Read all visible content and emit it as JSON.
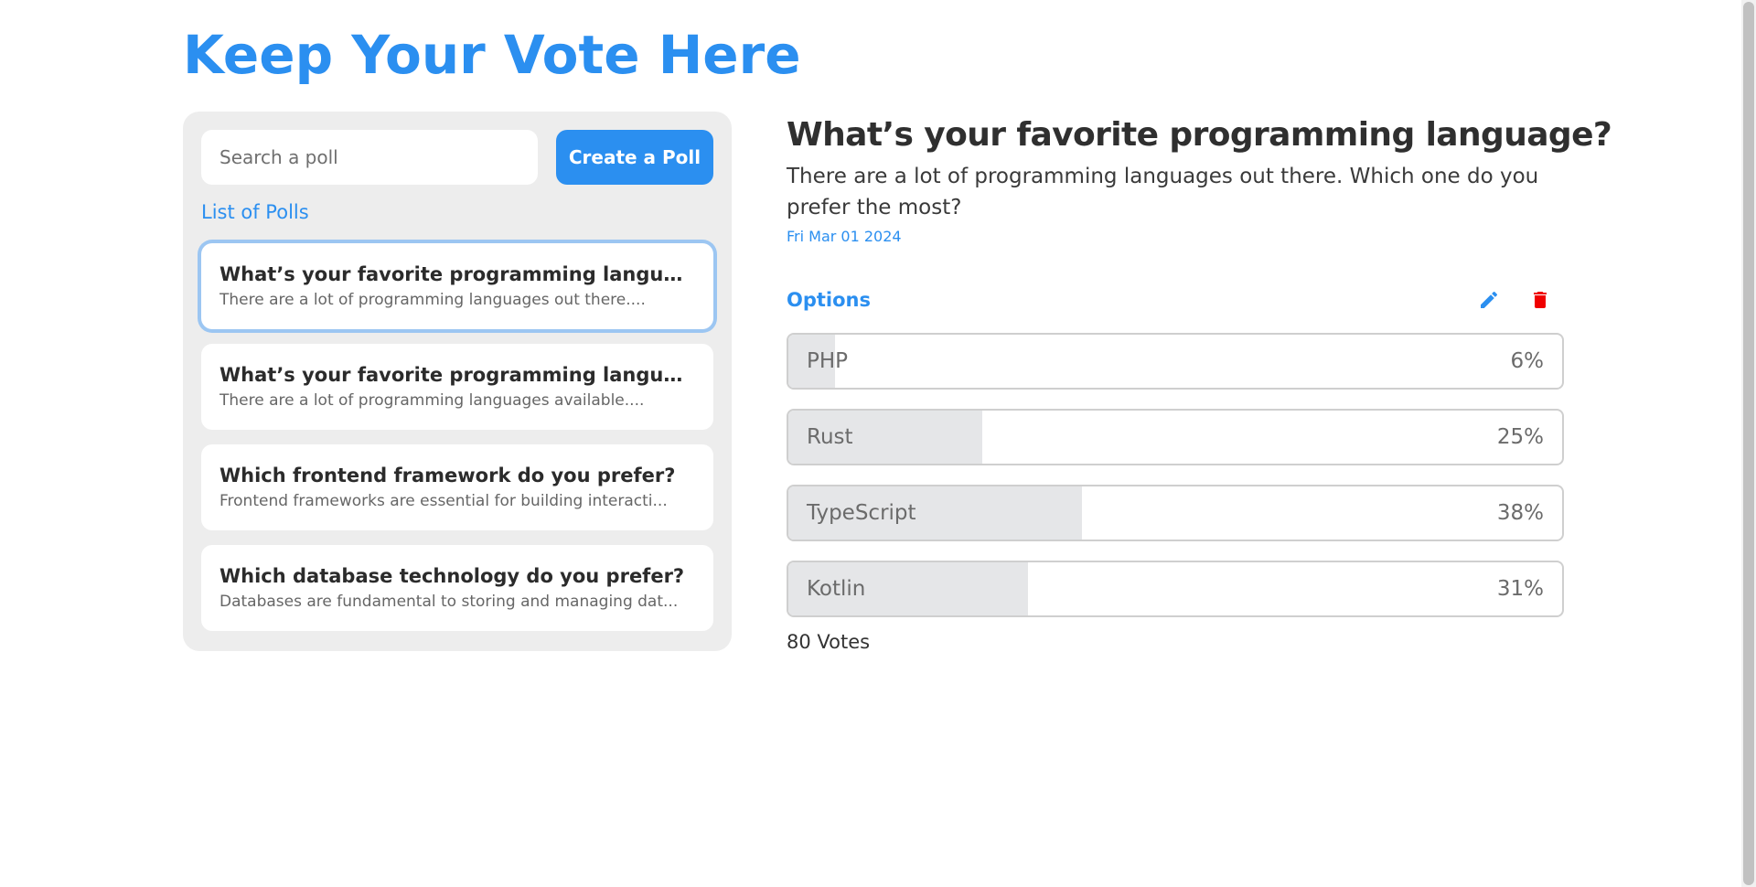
{
  "app": {
    "title": "Keep Your Vote Here"
  },
  "colors": {
    "accent": "#2b8ff0",
    "danger": "#f00000",
    "sidebar_bg": "#ededed",
    "bar_fill": "#e5e6e8"
  },
  "sidebar": {
    "search_placeholder": "Search a poll",
    "create_label": "Create a Poll",
    "list_heading": "List of Polls",
    "polls": [
      {
        "title": "What’s your favorite programming language?",
        "description": "There are a lot of programming languages out there....",
        "selected": true
      },
      {
        "title": "What’s your favorite programming language?",
        "description": "There are a lot of programming languages available....",
        "selected": false
      },
      {
        "title": "Which frontend framework do you prefer?",
        "description": "Frontend frameworks are essential for building interacti...",
        "selected": false
      },
      {
        "title": "Which database technology do you prefer?",
        "description": "Databases are fundamental to storing and managing dat...",
        "selected": false
      }
    ]
  },
  "detail": {
    "title": "What’s your favorite programming language?",
    "description": "There are a lot of programming languages out there. Which one do you prefer the most?",
    "date": "Fri Mar 01 2024",
    "options_label": "Options",
    "edit_icon": "pencil-icon",
    "delete_icon": "trash-icon",
    "options": [
      {
        "name": "PHP",
        "percent_label": "6%",
        "percent": 6
      },
      {
        "name": "Rust",
        "percent_label": "25%",
        "percent": 25
      },
      {
        "name": "TypeScript",
        "percent_label": "38%",
        "percent": 38
      },
      {
        "name": "Kotlin",
        "percent_label": "31%",
        "percent": 31
      }
    ],
    "votes_label": "80 Votes"
  }
}
